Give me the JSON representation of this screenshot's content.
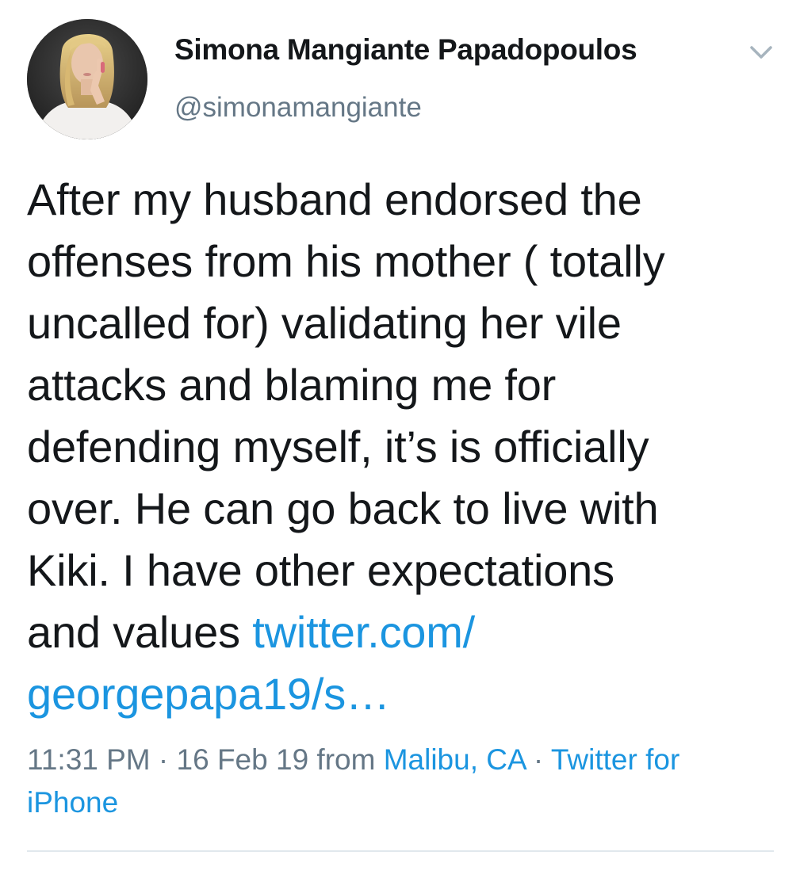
{
  "user": {
    "display_name": "Simona Mangiante Papadopoulos",
    "handle": "@simonamangiante",
    "avatar_icon": "profile-photo"
  },
  "menu": {
    "caret_icon": "chevron-down-icon"
  },
  "tweet": {
    "text_lines": [
      "After my husband endorsed the",
      "offenses from his mother ( totally",
      "uncalled for) validating her vile",
      "attacks and blaming me for",
      "defending myself, it’s is officially",
      "over. He can go back to live with",
      "Kiki. I have other expectations"
    ],
    "last_line_text": "and values ",
    "link_part1": "twitter.com/",
    "link_part2": "georgepapa19/s…"
  },
  "meta": {
    "time": "11:31 PM",
    "sep1": " · ",
    "date": "16 Feb 19",
    "from_label": " from ",
    "location": "Malibu, CA",
    "sep2": " · ",
    "source_part1": "Twitter for",
    "source_part2": "iPhone"
  },
  "colors": {
    "link": "#1b95e0",
    "secondary_text": "#657786",
    "primary_text": "#14171a",
    "divider": "#e1e8ed"
  }
}
